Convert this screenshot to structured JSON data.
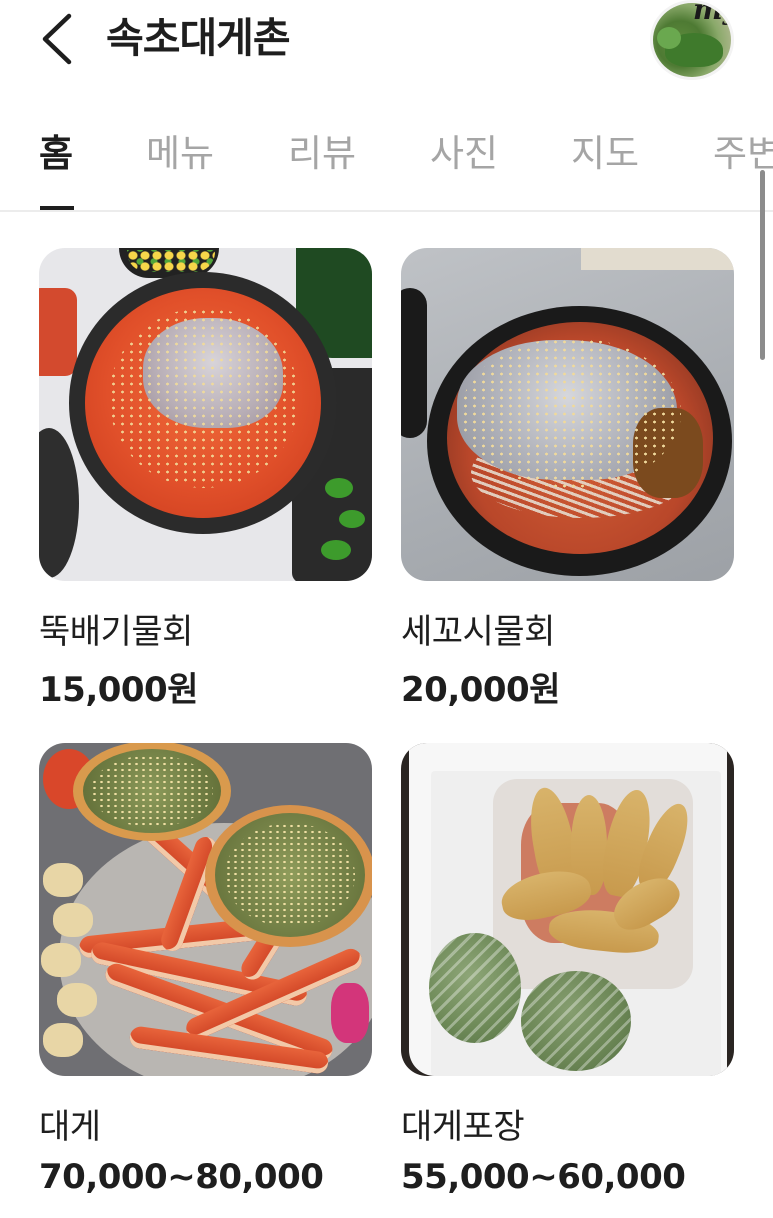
{
  "header": {
    "title": "속초대게촌",
    "avatar_text": "my"
  },
  "tabs": [
    {
      "label": "홈",
      "active": true
    },
    {
      "label": "메뉴",
      "active": false
    },
    {
      "label": "리뷰",
      "active": false
    },
    {
      "label": "사진",
      "active": false
    },
    {
      "label": "지도",
      "active": false
    },
    {
      "label": "주변",
      "active": false
    }
  ],
  "menu": [
    {
      "name": "뚝배기물회",
      "price": "15,000원"
    },
    {
      "name": "세꼬시물회",
      "price": "20,000원"
    },
    {
      "name": "대게",
      "price": "70,000~80,000"
    },
    {
      "name": "대게포장",
      "price": "55,000~60,000"
    }
  ],
  "colors": {
    "text": "#1e1e1e",
    "tab_inactive": "#a5a5a5",
    "divider": "#ececec",
    "background": "#ffffff"
  }
}
